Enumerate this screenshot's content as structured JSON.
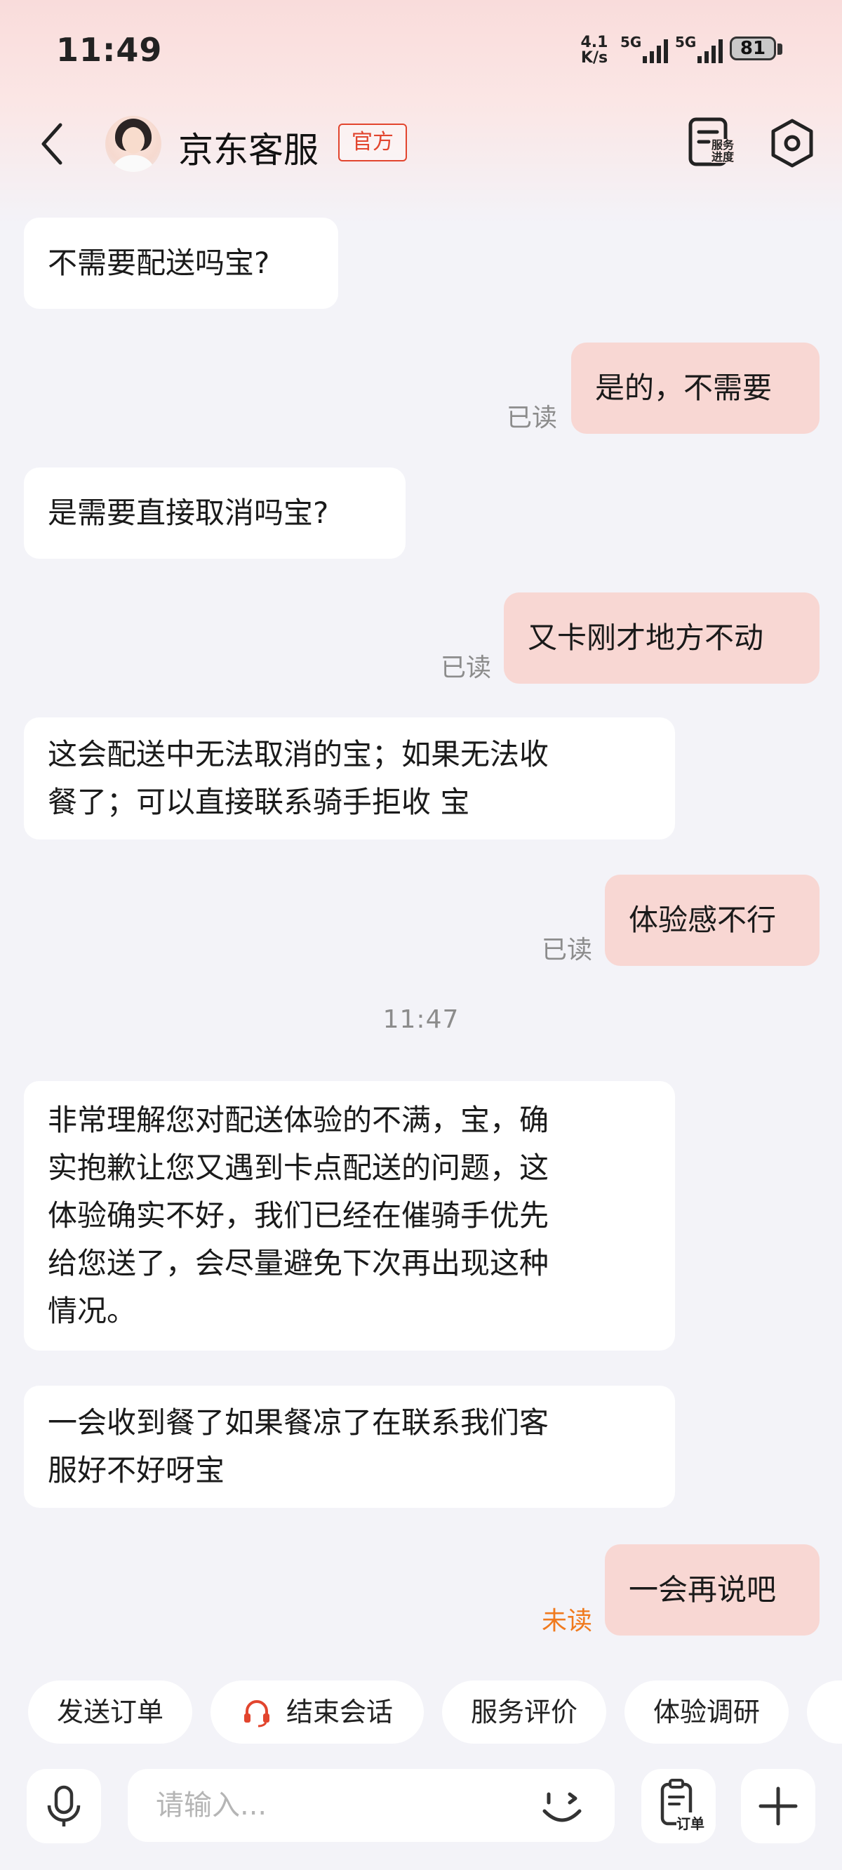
{
  "status_bar": {
    "time": "11:49",
    "net_speed_value": "4.1",
    "net_speed_unit": "K/s",
    "signal_1_label": "5G",
    "signal_2_label": "5G",
    "battery_percent": "81"
  },
  "header": {
    "title": "京东客服",
    "badge": "官方",
    "service_progress_label_line1": "服务",
    "service_progress_label_line2": "进度"
  },
  "messages": [
    {
      "side": "left",
      "text": "不需要配送吗宝?"
    },
    {
      "side": "right",
      "text": "是的，不需要",
      "status": "已读"
    },
    {
      "side": "left",
      "text": "是需要直接取消吗宝?"
    },
    {
      "side": "right",
      "text": "又卡刚才地方不动",
      "status": "已读"
    },
    {
      "side": "left",
      "lines": [
        "这会配送中无法取消的宝；如果无法收",
        "餐了；可以直接联系骑手拒收 宝"
      ]
    },
    {
      "side": "right",
      "text": "体验感不行",
      "status": "已读"
    },
    {
      "side": "left",
      "lines": [
        "非常理解您对配送体验的不满，宝，确",
        "实抱歉让您又遇到卡点配送的问题，这",
        "体验确实不好，我们已经在催骑手优先",
        "给您送了，会尽量避免下次再出现这种",
        "情况。"
      ]
    },
    {
      "side": "left",
      "lines": [
        "一会收到餐了如果餐凉了在联系我们客",
        "服好不好呀宝"
      ]
    },
    {
      "side": "right",
      "text": "一会再说吧",
      "status": "未读"
    }
  ],
  "timestamp": "11:47",
  "quick_actions": [
    "发送订单",
    "结束会话",
    "服务评价",
    "体验调研"
  ],
  "input": {
    "placeholder": "请输入...",
    "order_label": "订单"
  },
  "colors": {
    "accent": "#e2452e",
    "bubble_self": "#f8d7d3",
    "bubble_other": "#ffffff",
    "unread": "#f07a1e",
    "background": "#f3f3f8"
  }
}
